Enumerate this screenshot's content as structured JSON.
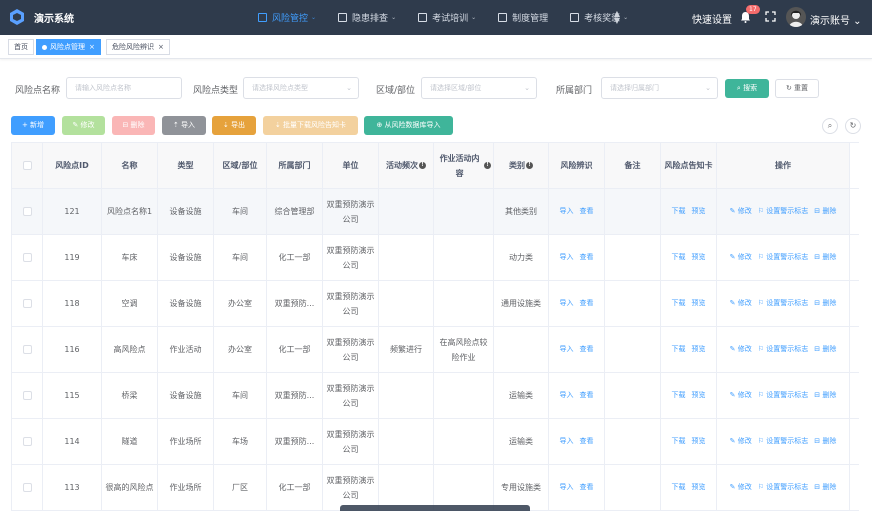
{
  "app": {
    "title": "演示系统"
  },
  "nav": [
    {
      "label": "风险管控",
      "caret": "⌄"
    },
    {
      "label": "隐患排查",
      "caret": "⌄"
    },
    {
      "label": "考试培训",
      "caret": "⌄"
    },
    {
      "label": "制度管理",
      "caret": ""
    },
    {
      "label": "考核奖惩",
      "caret": "⌄"
    }
  ],
  "header": {
    "quick_settings": "快速设置",
    "badge": "17",
    "username": "演示账号"
  },
  "tabs": [
    {
      "label": "首页"
    },
    {
      "label": "风险点管理"
    },
    {
      "label": "危险风险辨识"
    }
  ],
  "filters": {
    "name_label": "风险点名称",
    "name_placeholder": "请输入风险点名称",
    "type_label": "风险点类型",
    "type_placeholder": "请选择风险点类型",
    "area_label": "区域/部位",
    "area_placeholder": "请选择区域/部位",
    "dept_label": "所属部门",
    "dept_placeholder": "请选择归属部门",
    "search_label": "搜索",
    "reset_label": "重置"
  },
  "toolbar": {
    "add": "+ 新增",
    "edit": "✎ 修改",
    "delete": "⊟ 删除",
    "import": "⇡ 导入",
    "export": "⇣ 导出",
    "batch": "⇣ 批量下载风险告知卡",
    "from_lib": "从风险数据库导入"
  },
  "table": {
    "headers": [
      "风险点ID",
      "名称",
      "类型",
      "区域/部位",
      "所属部门",
      "单位",
      "活动频次",
      "作业活动内容",
      "类别",
      "风险辨识",
      "备注",
      "风险点告知卡",
      "操作"
    ],
    "link_import": "导入",
    "link_view": "查看",
    "link_download": "下载",
    "link_preview": "预览",
    "op_edit": "修改",
    "op_warn": "设置警示标志",
    "op_delete": "删除",
    "rows": [
      {
        "id": "121",
        "name": "风险点名称1",
        "type": "设备设施",
        "area": "车间",
        "dept": "综合管理部",
        "unit": "双重预防演示公司",
        "freq": "",
        "content": "",
        "category": "其他类别",
        "remark": ""
      },
      {
        "id": "119",
        "name": "车床",
        "type": "设备设施",
        "area": "车间",
        "dept": "化工一部",
        "unit": "双重预防演示公司",
        "freq": "",
        "content": "",
        "category": "动力类",
        "remark": ""
      },
      {
        "id": "118",
        "name": "空调",
        "type": "设备设施",
        "area": "办公室",
        "dept": "双重预防...",
        "unit": "双重预防演示公司",
        "freq": "",
        "content": "",
        "category": "通用设施类",
        "remark": ""
      },
      {
        "id": "116",
        "name": "高风险点",
        "type": "作业活动",
        "area": "办公室",
        "dept": "化工一部",
        "unit": "双重预防演示公司",
        "freq": "频繁进行",
        "content": "在高风险点较险作业",
        "category": "",
        "remark": ""
      },
      {
        "id": "115",
        "name": "桥梁",
        "type": "设备设施",
        "area": "车间",
        "dept": "双重预防...",
        "unit": "双重预防演示公司",
        "freq": "",
        "content": "",
        "category": "运输类",
        "remark": ""
      },
      {
        "id": "114",
        "name": "隧道",
        "type": "作业场所",
        "area": "车场",
        "dept": "双重预防...",
        "unit": "双重预防演示公司",
        "freq": "",
        "content": "",
        "category": "运输类",
        "remark": ""
      },
      {
        "id": "113",
        "name": "很高的风险点",
        "type": "作业场所",
        "area": "厂区",
        "dept": "化工一部",
        "unit": "双重预防演示公司",
        "freq": "",
        "content": "",
        "category": "专用设施类",
        "remark": ""
      }
    ]
  },
  "colors": {
    "topbar": "#2f3b4c",
    "primary": "#409eff",
    "success": "#67c23a",
    "danger": "#f56c6c",
    "warning": "#e6a23c",
    "teal": "#3fb59a",
    "info": "#909399"
  }
}
